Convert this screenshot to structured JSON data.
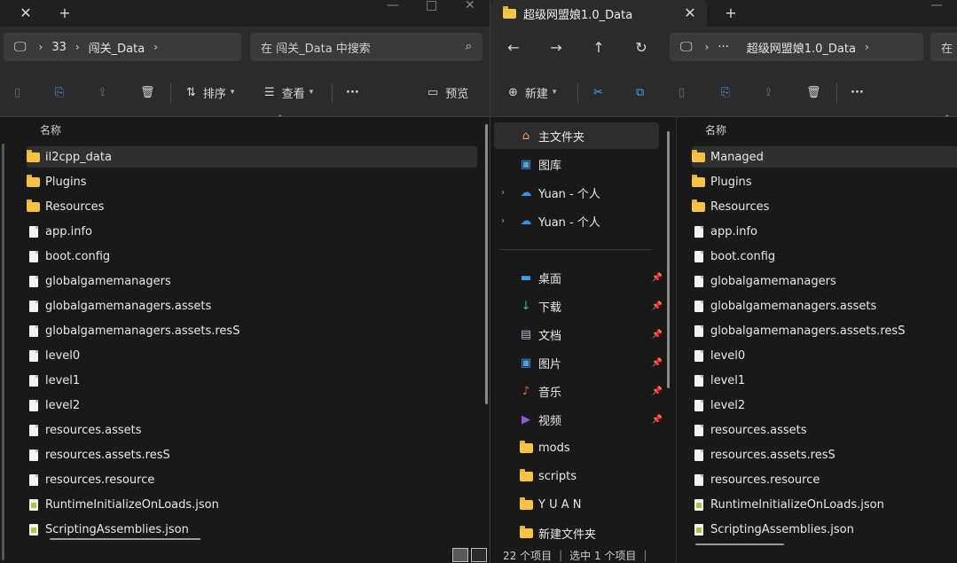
{
  "left_window": {
    "tab_title": "",
    "breadcrumb": [
      "33",
      "闯关_Data"
    ],
    "search_placeholder": "在 闯关_Data 中搜索",
    "toolbar": {
      "sort_label": "排序",
      "view_label": "查看",
      "preview_label": "预览"
    },
    "column_header": "名称",
    "files": [
      {
        "name": "il2cpp_data",
        "type": "folder",
        "selected": true
      },
      {
        "name": "Plugins",
        "type": "folder"
      },
      {
        "name": "Resources",
        "type": "folder"
      },
      {
        "name": "app.info",
        "type": "file"
      },
      {
        "name": "boot.config",
        "type": "file"
      },
      {
        "name": "globalgamemanagers",
        "type": "file"
      },
      {
        "name": "globalgamemanagers.assets",
        "type": "file"
      },
      {
        "name": "globalgamemanagers.assets.resS",
        "type": "file"
      },
      {
        "name": "level0",
        "type": "file"
      },
      {
        "name": "level1",
        "type": "file"
      },
      {
        "name": "level2",
        "type": "file"
      },
      {
        "name": "resources.assets",
        "type": "file"
      },
      {
        "name": "resources.assets.resS",
        "type": "file"
      },
      {
        "name": "resources.resource",
        "type": "file"
      },
      {
        "name": "RuntimeInitializeOnLoads.json",
        "type": "json"
      },
      {
        "name": "ScriptingAssemblies.json",
        "type": "json"
      }
    ]
  },
  "right_window": {
    "tab_title": "超级网盟娘1.0_Data",
    "breadcrumb": [
      "···",
      "超级网盟娘1.0_Data"
    ],
    "search_placeholder": "在",
    "toolbar": {
      "new_label": "新建"
    },
    "column_header": "名称",
    "nav": [
      {
        "label": "主文件夹",
        "icon": "home-icon",
        "glyph": "⌂",
        "color": "#f0a060",
        "active": true
      },
      {
        "label": "图库",
        "icon": "gallery-icon",
        "glyph": "▣",
        "color": "#4aa3e8"
      },
      {
        "label": "Yuan - 个人",
        "icon": "onedrive-icon",
        "glyph": "☁",
        "color": "#3b8fe0",
        "expandable": true
      },
      {
        "label": "Yuan - 个人",
        "icon": "onedrive-icon",
        "glyph": "☁",
        "color": "#3b8fe0",
        "expandable": true
      },
      {
        "label": "桌面",
        "icon": "desktop-icon",
        "glyph": "▬",
        "color": "#3aa0e0",
        "pinned": true
      },
      {
        "label": "下载",
        "icon": "download-icon",
        "glyph": "↓",
        "color": "#3fbf8f",
        "pinned": true
      },
      {
        "label": "文档",
        "icon": "documents-icon",
        "glyph": "▤",
        "color": "#a8b8c8",
        "pinned": true
      },
      {
        "label": "图片",
        "icon": "pictures-icon",
        "glyph": "▣",
        "color": "#4aa3e8",
        "pinned": true
      },
      {
        "label": "音乐",
        "icon": "music-icon",
        "glyph": "♪",
        "color": "#e8663a",
        "pinned": true
      },
      {
        "label": "视频",
        "icon": "video-icon",
        "glyph": "▶",
        "color": "#8a5ad8",
        "pinned": true
      },
      {
        "label": "mods",
        "icon": "folder-icon",
        "glyph": "",
        "color": "#f6c343"
      },
      {
        "label": "scripts",
        "icon": "folder-icon",
        "glyph": "",
        "color": "#f6c343"
      },
      {
        "label": "Y U A N",
        "icon": "folder-icon",
        "glyph": "",
        "color": "#f6c343"
      },
      {
        "label": "新建文件夹",
        "icon": "folder-icon",
        "glyph": "",
        "color": "#f6c343"
      }
    ],
    "files": [
      {
        "name": "Managed",
        "type": "folder",
        "selected": true
      },
      {
        "name": "Plugins",
        "type": "folder"
      },
      {
        "name": "Resources",
        "type": "folder"
      },
      {
        "name": "app.info",
        "type": "file"
      },
      {
        "name": "boot.config",
        "type": "file"
      },
      {
        "name": "globalgamemanagers",
        "type": "file"
      },
      {
        "name": "globalgamemanagers.assets",
        "type": "file"
      },
      {
        "name": "globalgamemanagers.assets.resS",
        "type": "file"
      },
      {
        "name": "level0",
        "type": "file"
      },
      {
        "name": "level1",
        "type": "file"
      },
      {
        "name": "level2",
        "type": "file"
      },
      {
        "name": "resources.assets",
        "type": "file"
      },
      {
        "name": "resources.assets.resS",
        "type": "file"
      },
      {
        "name": "resources.resource",
        "type": "file"
      },
      {
        "name": "RuntimeInitializeOnLoads.json",
        "type": "json"
      },
      {
        "name": "ScriptingAssemblies.json",
        "type": "json"
      }
    ],
    "status": {
      "count": "22 个项目",
      "selection": "选中 1 个项目"
    }
  }
}
